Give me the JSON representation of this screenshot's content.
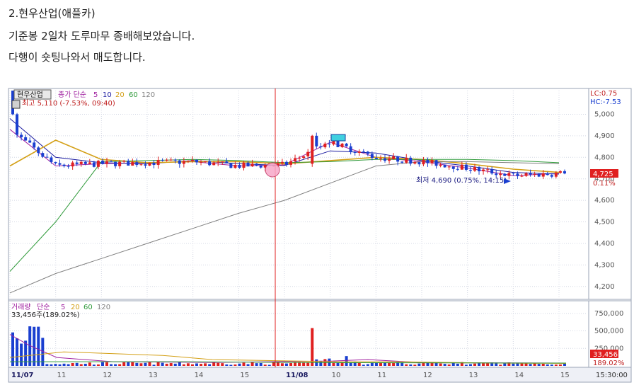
{
  "post": {
    "line1": "2.현우산업(애플카)",
    "line2": "기준봉 2일차 도루마무 종배해보았습니다.",
    "line3": "다행이 숏팅나와서 매도합니다."
  },
  "price_panel": {
    "stock_name": "현우산업",
    "ma_label": "종가 단순",
    "ma_periods": [
      "5",
      "10",
      "20",
      "60",
      "120"
    ],
    "high_text": "최고 5,110 (-7.53%, 09:40)",
    "low_text": "최저 4,690 (0.75%, 14:15)",
    "lc_text": "LC:0.75",
    "hc_text": "HC:-7.53",
    "current_price": "4,725",
    "current_change": "0.11%",
    "price_ticks": [
      "5,000",
      "4,900",
      "4,800",
      "4,700",
      "4,600",
      "4,500",
      "4,400",
      "4,300",
      "4,200"
    ]
  },
  "volume_panel": {
    "label": "거래량",
    "ma_label": "단순",
    "ma_periods": [
      "5",
      "20",
      "60",
      "120"
    ],
    "value_text": "33,456주(189.02%)",
    "volume_ticks": [
      "750,000",
      "500,000",
      "250,000"
    ],
    "current_volume": "33,456",
    "current_volume_pct": "189.02%"
  },
  "time_axis": {
    "labels": [
      "11/07",
      "11",
      "12",
      "13",
      "14",
      "15",
      "11/08",
      "10",
      "11",
      "12",
      "13",
      "14",
      "15"
    ],
    "last_time": "15:30:00"
  },
  "colors": {
    "up": "#e02020",
    "down": "#1a3fd0",
    "ma5": "#a020a0",
    "ma10": "#1a1aa0",
    "ma20": "#d4a017",
    "ma60": "#2f9a3a",
    "ma120": "#808080",
    "grid": "#d4d8e4",
    "axis_text": "#555555",
    "current_bg": "#e02020"
  },
  "chart_data": {
    "type": "candlestick",
    "x": [
      "11/07",
      "11",
      "12",
      "13",
      "14",
      "15",
      "11/08",
      "10",
      "11",
      "12",
      "13",
      "14",
      "15"
    ],
    "ylim": [
      4150,
      5110
    ],
    "high": 5110,
    "low": 4690,
    "close": 4725,
    "volume_ylim": [
      0,
      900000
    ],
    "series": [
      {
        "name": "5",
        "values": [
          4930,
          4760,
          4770,
          4775,
          4780,
          4760,
          4765,
          4870,
          4800,
          4780,
          4750,
          4715,
          4725
        ]
      },
      {
        "name": "10",
        "values": [
          4980,
          4800,
          4775,
          4770,
          4785,
          4770,
          4762,
          4830,
          4820,
          4785,
          4760,
          4730,
          4722
        ]
      },
      {
        "name": "20",
        "values": [
          4760,
          4880,
          4790,
          4775,
          4780,
          4780,
          4770,
          4785,
          4800,
          4790,
          4770,
          4745,
          4730
        ]
      },
      {
        "name": "60",
        "values": [
          4270,
          4500,
          4780,
          4785,
          4790,
          4785,
          4775,
          4780,
          4790,
          4790,
          4790,
          4785,
          4775
        ]
      },
      {
        "name": "120",
        "values": [
          4170,
          4260,
          4330,
          4400,
          4470,
          4540,
          4600,
          4680,
          4760,
          4780,
          4780,
          4775,
          4770
        ]
      }
    ]
  }
}
